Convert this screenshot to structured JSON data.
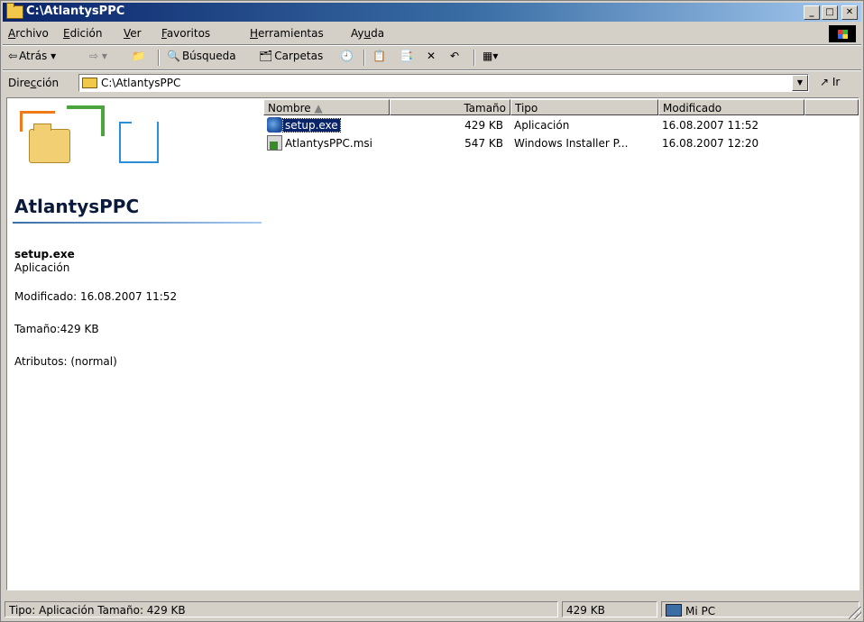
{
  "window": {
    "title": "C:\\AtlantysPPC"
  },
  "menu": [
    {
      "pre": "",
      "u": "A",
      "post": "rchivo"
    },
    {
      "pre": "",
      "u": "E",
      "post": "dición"
    },
    {
      "pre": "",
      "u": "V",
      "post": "er"
    },
    {
      "pre": "",
      "u": "F",
      "post": "avoritos"
    },
    {
      "pre": "",
      "u": "H",
      "post": "erramientas"
    },
    {
      "pre": "Ay",
      "u": "u",
      "post": "da"
    }
  ],
  "toolbar": {
    "back_label": "Atrás",
    "search_label": "Búsqueda",
    "folders_label": "Carpetas"
  },
  "address": {
    "label_pre": "Dire",
    "label_u": "c",
    "label_post": "ción",
    "value": "C:\\AtlantysPPC",
    "go_label": "Ir"
  },
  "details": {
    "app_name": "AtlantysPPC",
    "file_name": "setup.exe",
    "file_type": "Aplicación",
    "modified": "Modificado: 16.08.2007 11:52",
    "size": "Tamaño:429 KB",
    "attributes": "Atributos: (normal)"
  },
  "columns": {
    "name": "Nombre",
    "size": "Tamaño",
    "type": "Tipo",
    "modified": "Modificado"
  },
  "files": [
    {
      "name": "setup.exe",
      "size": "429 KB",
      "type": "Aplicación",
      "modified": "16.08.2007 11:52",
      "icon": "exe-icon",
      "selected": true
    },
    {
      "name": "AtlantysPPC.msi",
      "size": "547 KB",
      "type": "Windows Installer P...",
      "modified": "16.08.2007 12:20",
      "icon": "msi-icon",
      "selected": false
    }
  ],
  "status": {
    "info": "Tipo: Aplicación Tamaño: 429 KB",
    "size": "429 KB",
    "zone": "Mi PC"
  },
  "colors": {
    "title_gradient_start": "#0a246a",
    "title_gradient_end": "#a6caf0",
    "selection": "#0a246a",
    "chrome": "#d4d0c8"
  }
}
